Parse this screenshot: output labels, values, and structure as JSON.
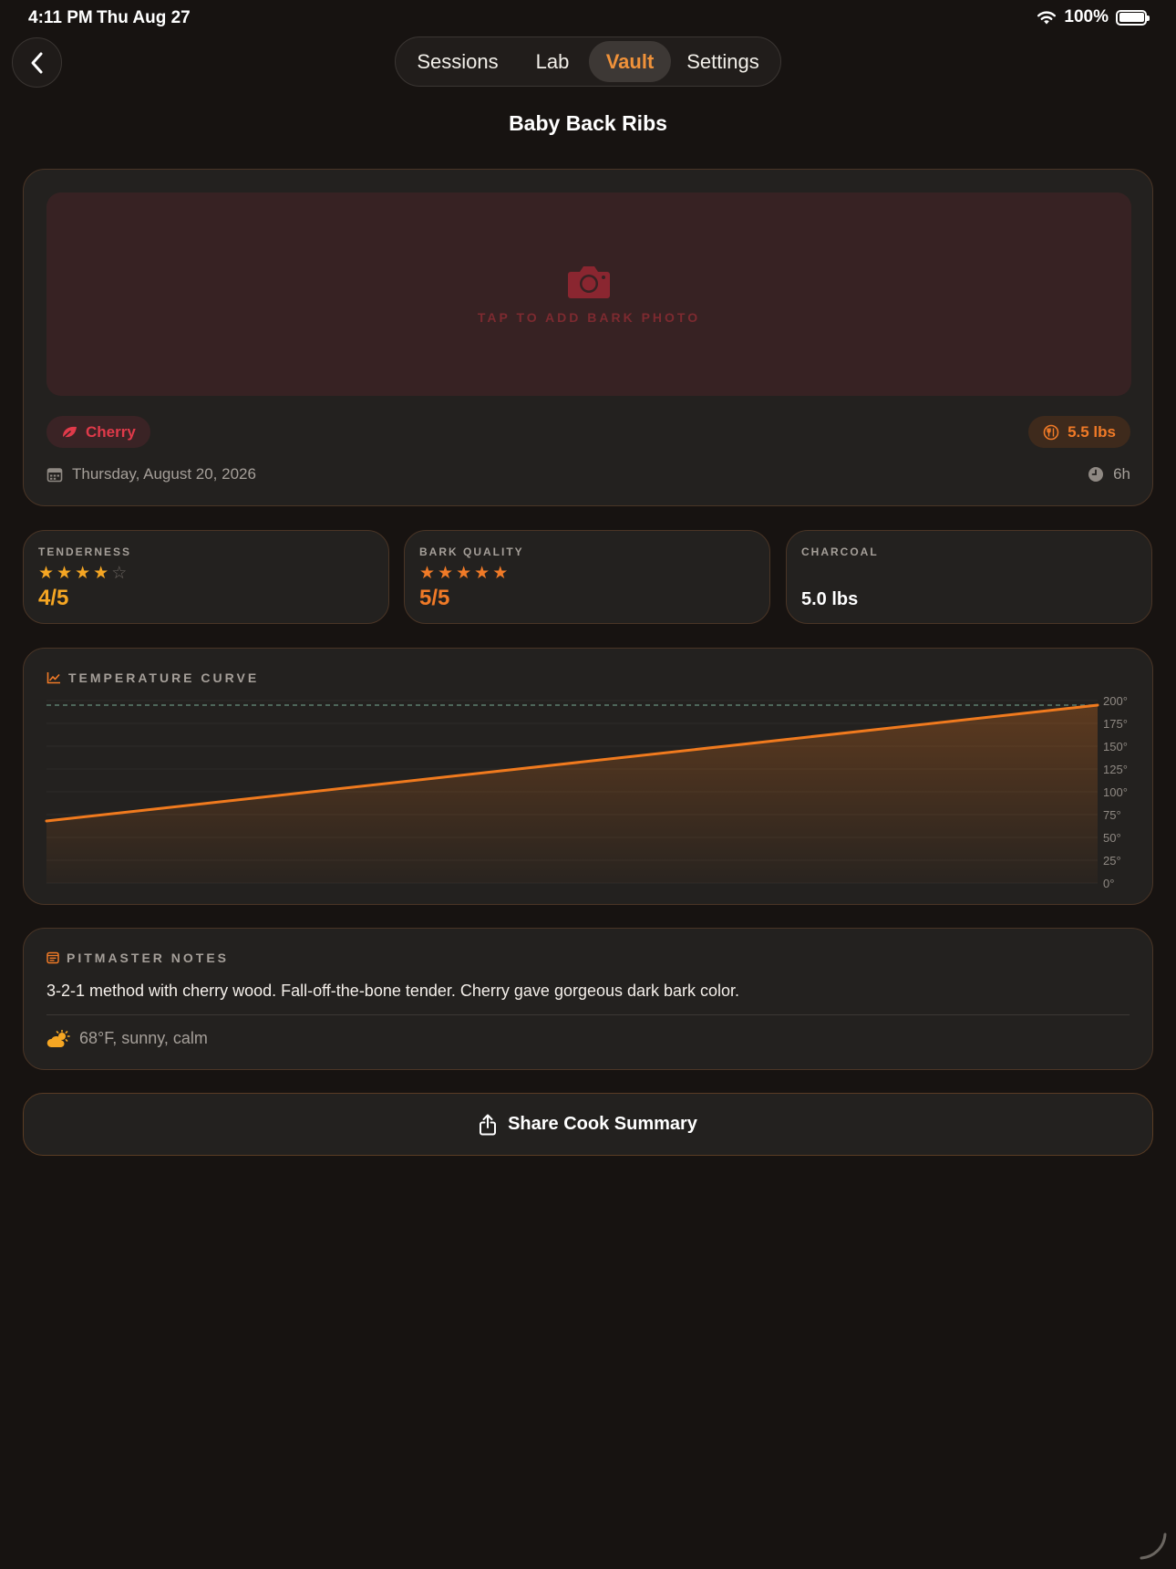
{
  "status_bar": {
    "time": "4:11 PM",
    "date": "Thu Aug 27",
    "battery": "100%"
  },
  "nav": {
    "back_icon": "chevron-left-icon",
    "tabs": [
      {
        "label": "Sessions",
        "active": false
      },
      {
        "label": "Lab",
        "active": false
      },
      {
        "label": "Vault",
        "active": true
      },
      {
        "label": "Settings",
        "active": false
      }
    ]
  },
  "page": {
    "title": "Baby Back Ribs"
  },
  "hero": {
    "photo_icon": "camera-icon",
    "photo_label": "TAP TO ADD BARK PHOTO",
    "wood_chip": {
      "icon": "leaf-icon",
      "label": "Cherry"
    },
    "weight_chip": {
      "icon": "utensils-icon",
      "label": "5.5 lbs"
    },
    "date": "Thursday, August 20, 2026",
    "duration": "6h"
  },
  "stats": [
    {
      "label": "TENDERNESS",
      "rating": 4,
      "max": 5,
      "value": "4/5"
    },
    {
      "label": "BARK QUALITY",
      "rating": 5,
      "max": 5,
      "value": "5/5"
    },
    {
      "label": "CHARCOAL",
      "value": "5.0 lbs"
    }
  ],
  "chart": {
    "heading": "TEMPERATURE CURVE",
    "icon": "chart-line-icon"
  },
  "chart_data": {
    "type": "area",
    "title": "TEMPERATURE CURVE",
    "x": [
      0,
      1
    ],
    "series": [
      {
        "values": [
          68,
          195
        ]
      }
    ],
    "target": 195,
    "ylim": [
      0,
      200
    ],
    "yticks": [
      "200°",
      "175°",
      "150°",
      "125°",
      "100°",
      "75°",
      "50°",
      "25°",
      "0°"
    ],
    "grid": true,
    "colors": {
      "line": "#f07a1e",
      "target": "#5c7d6e"
    }
  },
  "notes": {
    "heading": "PITMASTER NOTES",
    "icon": "notes-icon",
    "text": "3-2-1 method with cherry wood. Fall-off-the-bone tender. Cherry gave gorgeous dark bark color.",
    "weather_icon": "partly-sunny-icon",
    "weather": "68°F, sunny, calm"
  },
  "share": {
    "icon": "share-icon",
    "label": "Share Cook Summary"
  },
  "colors": {
    "accent": "#f07a27",
    "gold": "#f5a623",
    "wood": "#e03a4a",
    "background": "#171311"
  }
}
